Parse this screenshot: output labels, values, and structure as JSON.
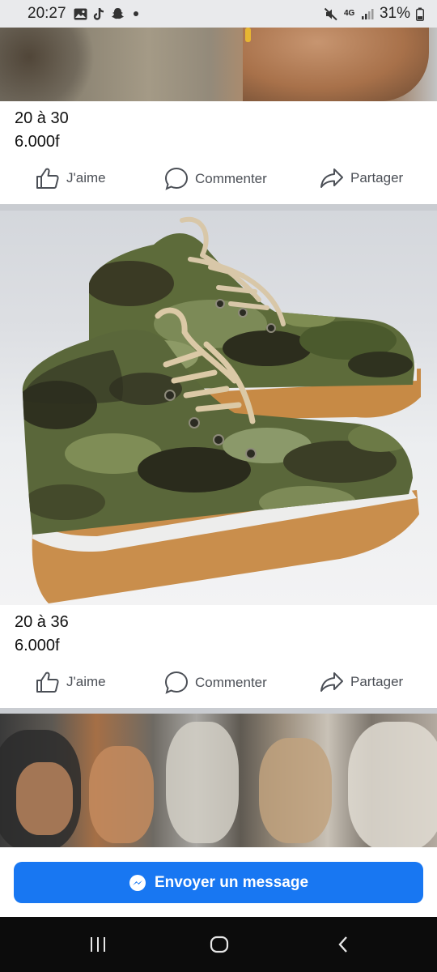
{
  "status_bar": {
    "time": "20:27",
    "network": "4G",
    "battery": "31%",
    "left_icons": [
      "gallery-icon",
      "tiktok-icon",
      "snapchat-icon",
      "notification-dot-icon"
    ],
    "right_icons": [
      "mute-icon",
      "network-4g-icon",
      "signal-icon",
      "battery-icon"
    ]
  },
  "posts": [
    {
      "caption_line1": "20 à 30",
      "caption_line2": "6.000f"
    },
    {
      "caption_line1": "20 à 36",
      "caption_line2": "6.000f"
    }
  ],
  "actions": {
    "like": "J'aime",
    "comment": "Commenter",
    "share": "Partager"
  },
  "composer": {
    "button_label": "Envoyer un message",
    "button_icon": "messenger-icon",
    "button_color": "#1877f2"
  },
  "nav": {
    "recents": "recents-icon",
    "home": "home-icon",
    "back": "back-icon"
  }
}
